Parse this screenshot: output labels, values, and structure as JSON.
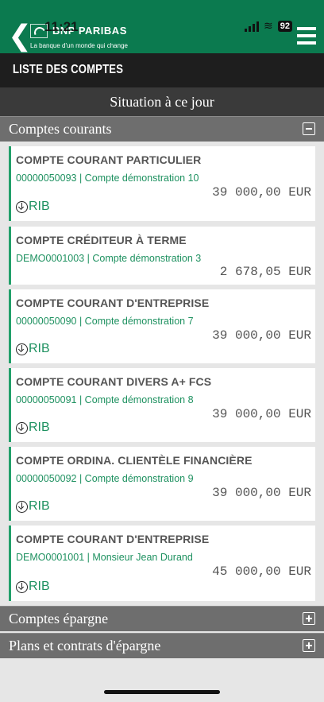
{
  "status": {
    "time": "11:21",
    "battery": "92"
  },
  "header": {
    "back": "❮",
    "bank_name": "BNP PARIBAS",
    "tagline": "La banque d'un monde qui change"
  },
  "page_title": "LISTE DES COMPTES",
  "situation": "Situation à ce jour",
  "sections": {
    "courants": "Comptes courants",
    "epargne": "Comptes épargne",
    "plans": "Plans et contrats d'épargne"
  },
  "rib_label": "RIB",
  "accounts": [
    {
      "name": "COMPTE COURANT PARTICULIER",
      "sub": "00000050093 | Compte démonstration 10",
      "amount": "39 000,00 EUR",
      "rib": true
    },
    {
      "name": "COMPTE CRÉDITEUR À TERME",
      "sub": "DEMO0001003 | Compte démonstration 3",
      "amount": "2 678,05 EUR",
      "rib": false
    },
    {
      "name": "COMPTE COURANT D'ENTREPRISE",
      "sub": "00000050090 | Compte démonstration 7",
      "amount": "39 000,00 EUR",
      "rib": true
    },
    {
      "name": "COMPTE COURANT DIVERS A+ FCS",
      "sub": "00000050091 | Compte démonstration 8",
      "amount": "39 000,00 EUR",
      "rib": true
    },
    {
      "name": "COMPTE ORDINA. CLIENTÈLE FINANCIÈRE",
      "sub": "00000050092 | Compte démonstration 9",
      "amount": "39 000,00 EUR",
      "rib": true
    },
    {
      "name": "COMPTE COURANT D'ENTREPRISE",
      "sub": "DEMO0001001 | Monsieur Jean Durand",
      "amount": "45 000,00 EUR",
      "rib": true
    }
  ]
}
